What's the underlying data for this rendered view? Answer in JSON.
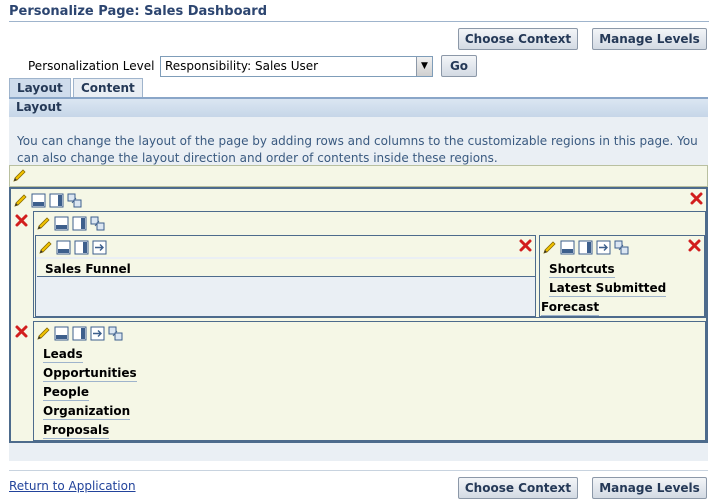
{
  "page": {
    "title": "Personalize Page: Sales Dashboard"
  },
  "toolbar": {
    "choose_context": "Choose Context",
    "manage_levels": "Manage Levels",
    "go": "Go"
  },
  "level": {
    "label": "Personalization Level",
    "value": "Responsibility: Sales User"
  },
  "tabs": [
    {
      "label": "Layout"
    },
    {
      "label": "Content"
    }
  ],
  "section": {
    "header": "Layout",
    "description": "You can change the layout of the page by adding rows and columns to the customizable regions in this page. You can also change the layout direction and order of contents inside these regions."
  },
  "regions": {
    "left_col_items": [
      "Sales Funnel"
    ],
    "right_col_items": [
      "Shortcuts",
      "Latest Submitted",
      "Forecast"
    ],
    "bottom_items": [
      "Leads",
      "Opportunities",
      "People",
      "Organization",
      "Proposals"
    ]
  },
  "footer": {
    "return_link": "Return to Application"
  },
  "icons": {
    "edit": "pencil-icon",
    "add_row": "add-row-icon",
    "add_column": "add-column-icon",
    "reorder": "reorder-icon",
    "move": "move-icon",
    "delete": "delete-icon"
  },
  "colors": {
    "accent": "#253957",
    "region_bg": "#f5f7e6",
    "panel_bg": "#eaeff4",
    "delete_red": "#d21e1e"
  }
}
